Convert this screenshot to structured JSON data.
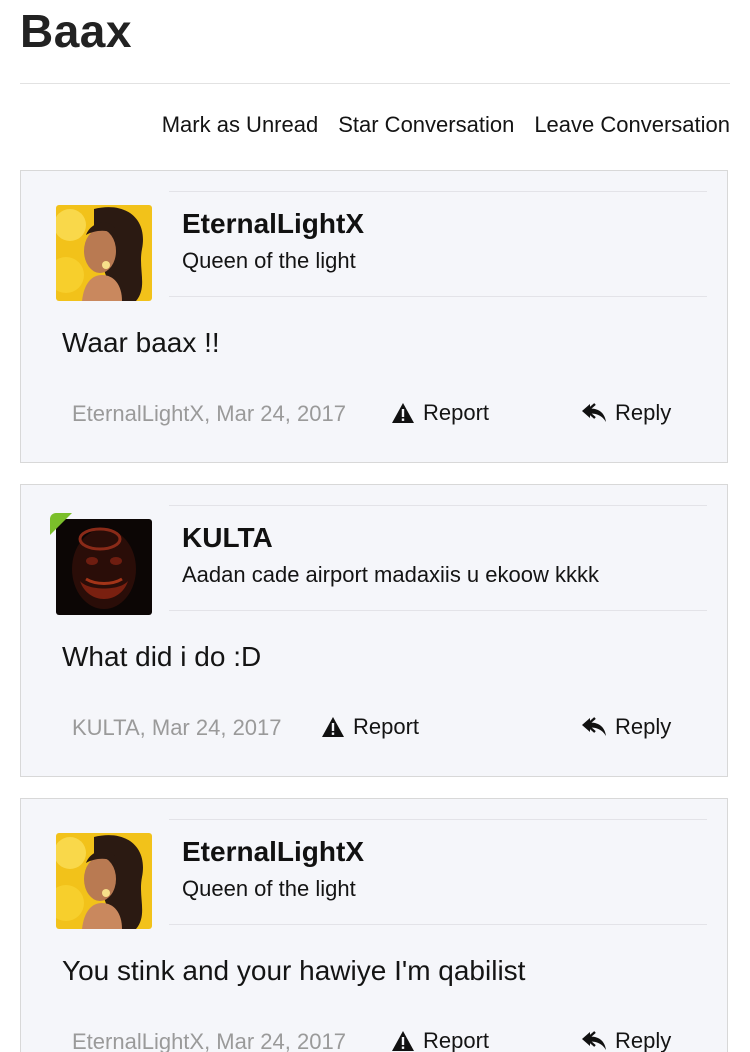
{
  "thread": {
    "title": "Baax"
  },
  "actions": {
    "mark_unread": "Mark as Unread",
    "star": "Star Conversation",
    "leave": "Leave Conversation"
  },
  "messages": [
    {
      "username": "EternalLightX",
      "user_title": "Queen of the light",
      "body": "Waar baax !!",
      "meta": "EternalLightX, Mar 24, 2017",
      "report_label": "Report",
      "reply_label": "Reply",
      "online": false
    },
    {
      "username": "KULTA",
      "user_title": "Aadan cade airport madaxiis u ekoow kkkk",
      "body": "What did i do :D",
      "meta": "KULTA, Mar 24, 2017",
      "report_label": "Report",
      "reply_label": "Reply",
      "online": true
    },
    {
      "username": "EternalLightX",
      "user_title": "Queen of the light",
      "body": "You stink and your hawiye I'm qabilist",
      "meta": "EternalLightX, Mar 24, 2017",
      "report_label": "Report",
      "reply_label": "Reply",
      "online": false
    }
  ],
  "colors": {
    "card_bg": "#f5f6fa",
    "card_border": "#d8d8d8",
    "meta_text": "#9a9a9a",
    "online_indicator": "#7bbf2a"
  },
  "icons": {
    "report": "warning-triangle-icon",
    "reply": "reply-arrow-icon"
  }
}
